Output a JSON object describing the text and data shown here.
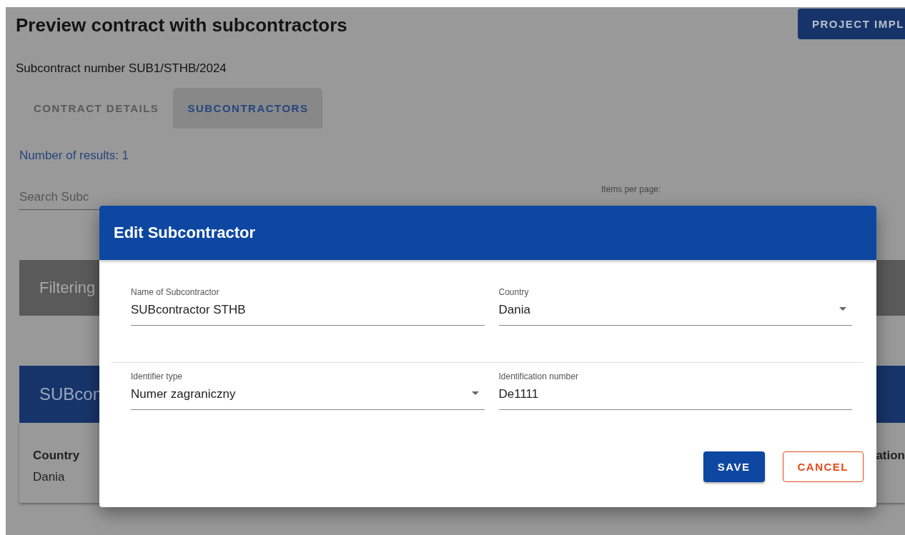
{
  "page": {
    "title": "Preview contract with subcontractors",
    "project_button": "PROJECT IMPL",
    "subcontract_number": "Subcontract number SUB1/STHB/2024",
    "tabs": [
      {
        "label": "CONTRACT DETAILS",
        "selected": false
      },
      {
        "label": "SUBCONTRACTORS",
        "selected": true
      }
    ],
    "results_count": "Number of results: 1",
    "search": {
      "placeholder": "Search Subc"
    },
    "items_per_page": {
      "label": "Items per page:"
    },
    "filter_panel": {
      "title": "Filtering"
    },
    "subcontractor_card": {
      "title": "SUBcon",
      "fields": [
        {
          "label": "Country",
          "value": "Dania"
        },
        {
          "label": "ation"
        }
      ]
    }
  },
  "dialog": {
    "title": "Edit Subcontractor",
    "rows": [
      [
        {
          "label": "Name of Subcontractor",
          "value": "SUBcontractor STHB",
          "kind": "text"
        },
        {
          "label": "Country",
          "value": "Dania",
          "kind": "select"
        }
      ],
      [
        {
          "label": "Identifier type",
          "value": "Numer zagraniczny",
          "kind": "select"
        },
        {
          "label": "Identification number",
          "value": "De1111",
          "kind": "text"
        }
      ]
    ],
    "buttons": [
      {
        "label": "SAVE",
        "kind": "primary"
      },
      {
        "label": "CANCEL",
        "kind": "outlined"
      }
    ]
  }
}
